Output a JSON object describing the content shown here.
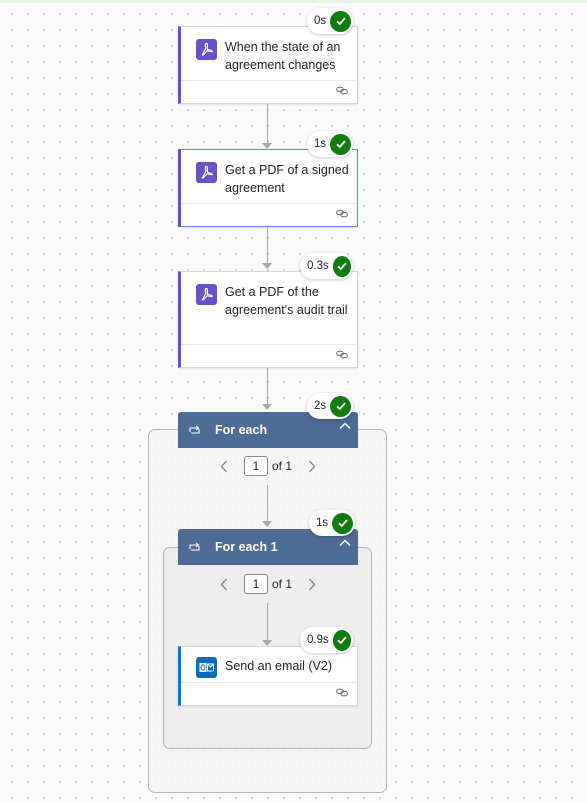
{
  "steps": [
    {
      "title": "When the state of an agreement changes",
      "duration": "0s"
    },
    {
      "title": "Get a PDF of a signed agreement",
      "duration": "1s"
    },
    {
      "title": "Get a PDF of the agreement's audit trail",
      "duration": "0.3s"
    }
  ],
  "for_each": {
    "title": "For each",
    "duration": "2s",
    "page": "1",
    "of": "of 1"
  },
  "for_each_1": {
    "title": "For each 1",
    "duration": "1s",
    "page": "1",
    "of": "of 1"
  },
  "send_email": {
    "title": "Send an email (V2)",
    "duration": "0.9s"
  },
  "colors": {
    "adobe": "#6b51c9",
    "loop_header": "#4e6b95",
    "success": "#107c10",
    "outlook": "#0f6cbd"
  },
  "icons": {
    "trigger": "adobe-sign-icon",
    "status": "success-check-icon",
    "loop": "loop-icon",
    "email": "outlook-icon"
  }
}
